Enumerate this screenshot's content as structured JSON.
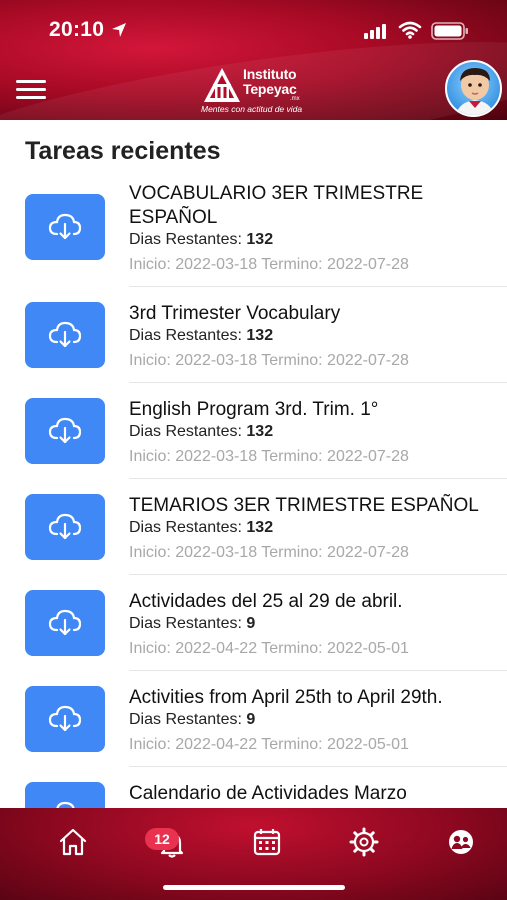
{
  "status_bar": {
    "time": "20:10"
  },
  "header": {
    "logo": {
      "line1": "Instituto",
      "line2": "Tepeyac",
      "suffix": ".mx",
      "tagline": "Mentes con actitud de vida"
    }
  },
  "main": {
    "section_title": "Tareas recientes",
    "remaining_label": "Dias Restantes: ",
    "tasks": [
      {
        "title": "VOCABULARIO 3ER TRIMESTRE ESPAÑOL",
        "days_remaining": "132",
        "dates": "Inicio: 2022-03-18 Termino: 2022-07-28"
      },
      {
        "title": "3rd Trimester Vocabulary",
        "days_remaining": "132",
        "dates": "Inicio: 2022-03-18 Termino: 2022-07-28"
      },
      {
        "title": "English Program 3rd. Trim. 1°",
        "days_remaining": "132",
        "dates": "Inicio: 2022-03-18 Termino: 2022-07-28"
      },
      {
        "title": "TEMARIOS 3ER TRIMESTRE ESPAÑOL",
        "days_remaining": "132",
        "dates": "Inicio: 2022-03-18 Termino: 2022-07-28"
      },
      {
        "title": "Actividades del 25 al 29 de abril.",
        "days_remaining": "9",
        "dates": "Inicio: 2022-04-22 Termino: 2022-05-01"
      },
      {
        "title": "Activities from April 25th to April 29th.",
        "days_remaining": "9",
        "dates": "Inicio: 2022-04-22 Termino: 2022-05-01"
      },
      {
        "title": "Calendario de Actividades Marzo",
        "days_remaining": "",
        "dates": ""
      }
    ]
  },
  "tabbar": {
    "notifications_badge": "12",
    "tabs": [
      "home-icon",
      "bell-icon",
      "calendar-icon",
      "settings-icon",
      "profile-icon"
    ]
  },
  "colors": {
    "brand_red": "#a70a25",
    "thumb_blue": "#3f88f5",
    "badge_red": "#e8324f"
  }
}
